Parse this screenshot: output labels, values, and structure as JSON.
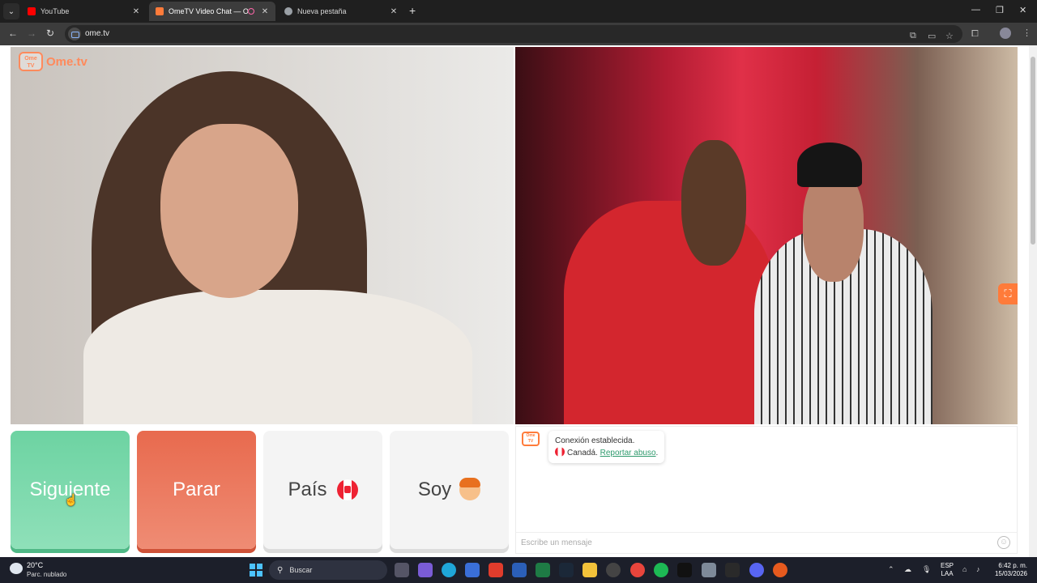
{
  "browser": {
    "tabs": [
      {
        "title": "YouTube",
        "favicon_color": "#ff0000"
      },
      {
        "title": "OmeTV Video Chat — Ome",
        "favicon_color": "#ff7b3a"
      },
      {
        "title": "Nueva pestaña",
        "favicon_color": "#9aa0a6"
      }
    ],
    "new_tab_label": "+",
    "url": "ome.tv"
  },
  "page": {
    "logo_text": "Ome.tv",
    "logo_badge": "Ome TV",
    "buttons": {
      "next": "Siguiente",
      "stop": "Parar",
      "country": "País",
      "soy": "Soy"
    },
    "chat": {
      "status": "Conexión establecida.",
      "country": "Canadá.",
      "report_link": "Reportar abuso",
      "period": ".",
      "input_placeholder": "Escribe un mensaje"
    },
    "colors": {
      "next": "#6dd3a2",
      "stop": "#e86a4e",
      "brand": "#ff7b3a"
    }
  },
  "taskbar": {
    "temperature": "20°C",
    "weather": "Parc. nublado",
    "search_label": "Buscar",
    "language_top": "ESP",
    "language_bottom": "LAA",
    "time": "6:42 p. m.",
    "date": "15/03/2026"
  }
}
